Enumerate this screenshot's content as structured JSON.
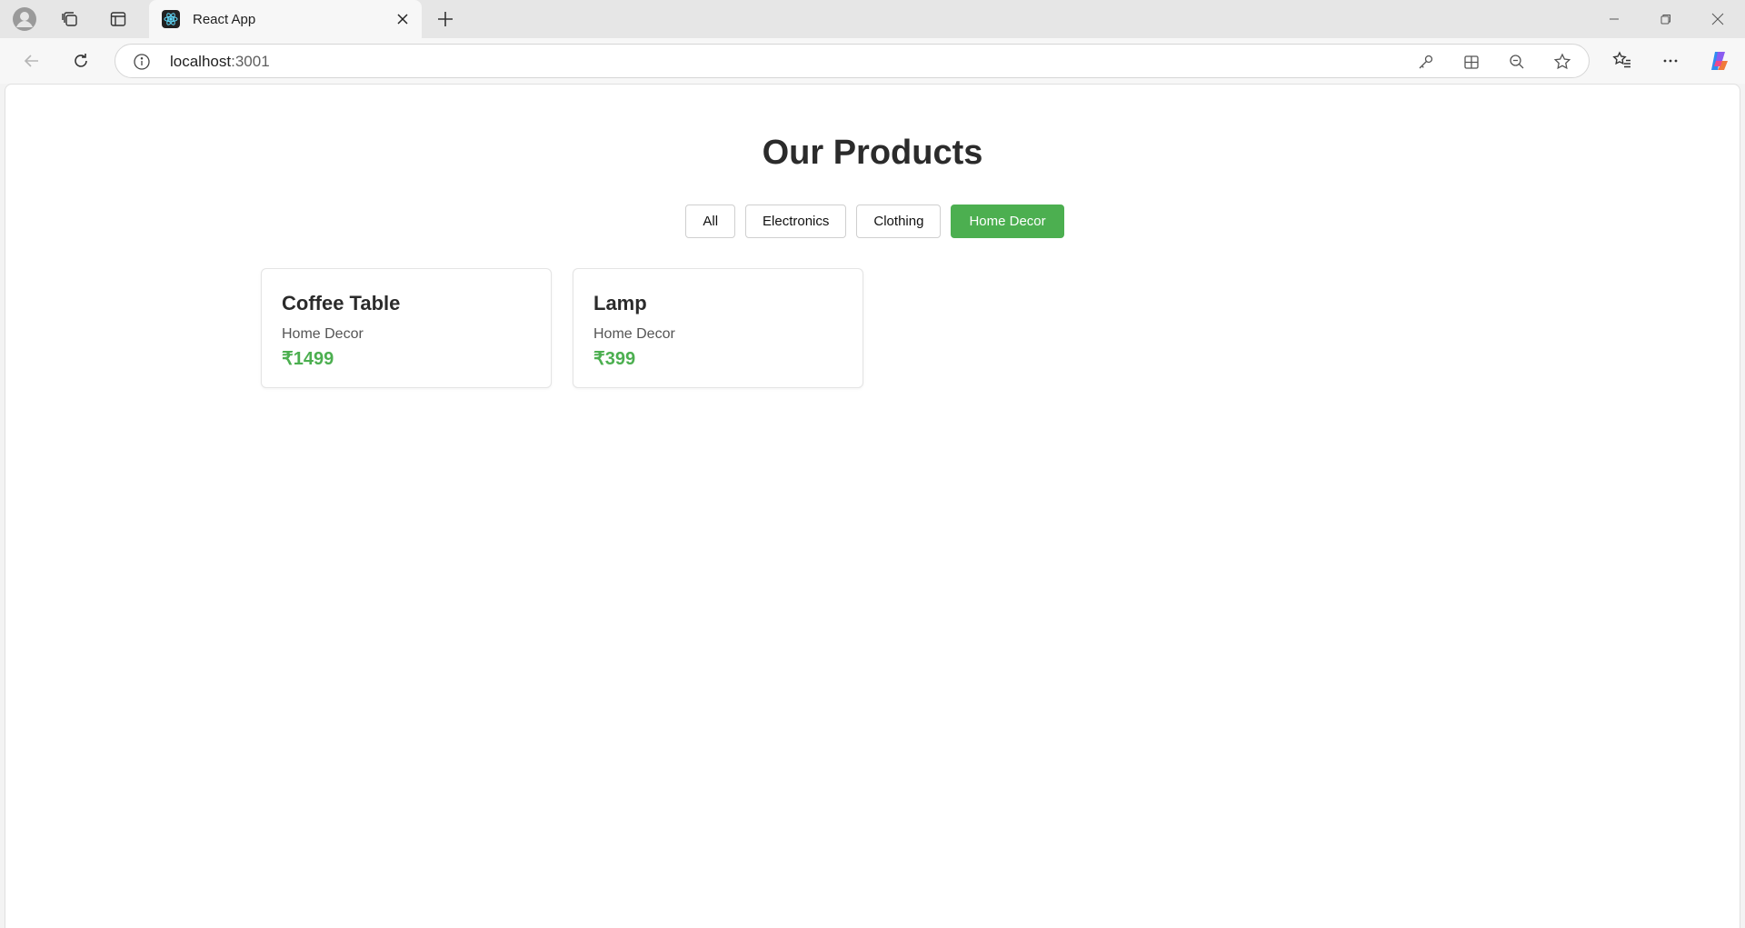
{
  "browser": {
    "tab_title": "React App",
    "url_host": "localhost",
    "url_port": ":3001"
  },
  "page": {
    "title": "Our Products",
    "filters": [
      {
        "label": "All",
        "active": false
      },
      {
        "label": "Electronics",
        "active": false
      },
      {
        "label": "Clothing",
        "active": false
      },
      {
        "label": "Home Decor",
        "active": true
      }
    ],
    "products": [
      {
        "name": "Coffee Table",
        "category": "Home Decor",
        "price": "₹1499"
      },
      {
        "name": "Lamp",
        "category": "Home Decor",
        "price": "₹399"
      }
    ]
  },
  "colors": {
    "accent": "#4caf50",
    "title_text": "#2b2b2b"
  }
}
